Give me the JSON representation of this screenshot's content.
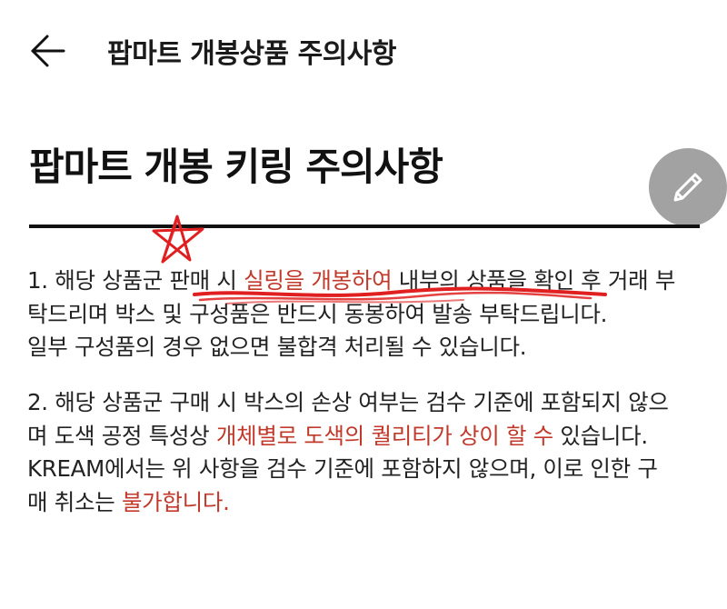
{
  "header": {
    "title": "팝마트 개봉상품 주의사항"
  },
  "document": {
    "title": "팝마트 개봉 키링 주의사항",
    "para1": {
      "line1_a": "1. 해당 상품군 판매 시 ",
      "line1_hl": "실링을 개봉하여",
      "line1_b": " 내부의 상품을 확인 후 거래 부",
      "line2": "탁드리며 박스 및 구성품은 반드시 동봉하여 발송 부탁드립니다.",
      "line3": "일부 구성품의 경우 없으면 불합격 처리될 수 있습니다."
    },
    "para2": {
      "line1": "2. 해당 상품군 구매 시 박스의 손상 여부는 검수 기준에 포함되지 않으",
      "line2_a": "며 도색 공정 특성상 ",
      "line2_hl": "개체별로 도색의 퀄리티가 상이 할 수",
      "line2_b": " 있습니다.",
      "line3": "KREAM에서는 위 사항을 검수 기준에 포함하지 않으며, 이로 인한 구",
      "line4_a": "매 취소는 ",
      "line4_hl": "불가합니다."
    }
  },
  "icons": {
    "back": "arrow-left-icon",
    "edit": "pencil-icon",
    "star_mark": "hand-drawn-star",
    "underline_mark": "hand-drawn-scribble"
  },
  "colors": {
    "highlight": "#c0392b",
    "annotation": "#e02020",
    "fab": "#9b9b9b",
    "text": "#222222"
  }
}
